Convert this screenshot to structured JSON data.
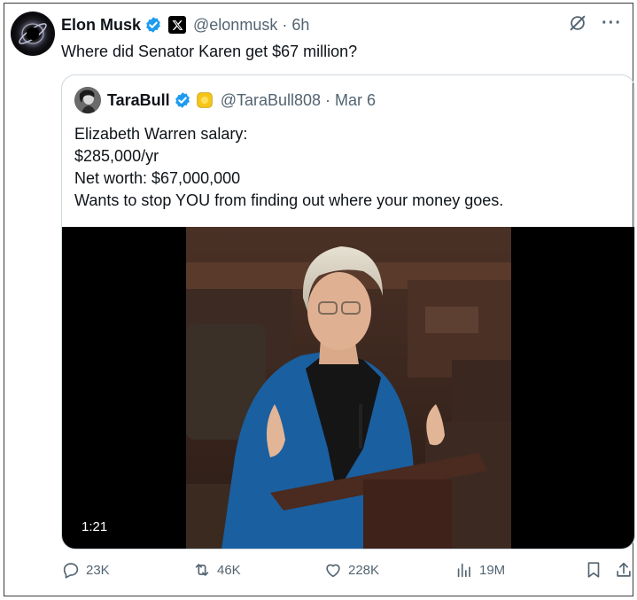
{
  "post": {
    "author_name": "Elon Musk",
    "author_handle": "@elonmusk",
    "separator": "·",
    "time": "6h",
    "text": "Where did Senator Karen get $67 million?"
  },
  "quote": {
    "author_name": "TaraBull",
    "author_handle": "@TaraBull808",
    "separator": "·",
    "date": "Mar 6",
    "lines": [
      "Elizabeth Warren salary:",
      "$285,000/yr",
      "Net worth: $67,000,000",
      "Wants to stop YOU from finding out where your money goes."
    ],
    "video": {
      "duration": "1:21"
    }
  },
  "actions": {
    "replies": "23K",
    "reposts": "46K",
    "likes": "228K",
    "views": "19M"
  },
  "colors": {
    "verified": "#1d9bf0",
    "muted_text": "#536471",
    "border": "#cfd9de",
    "blazer": "#1a5fa0"
  },
  "icons": [
    "verified-icon",
    "x-badge-icon",
    "grok-icon",
    "more-icon",
    "reply-icon",
    "repost-icon",
    "like-icon",
    "views-icon",
    "bookmark-icon",
    "share-icon",
    "gold-badge-icon"
  ]
}
